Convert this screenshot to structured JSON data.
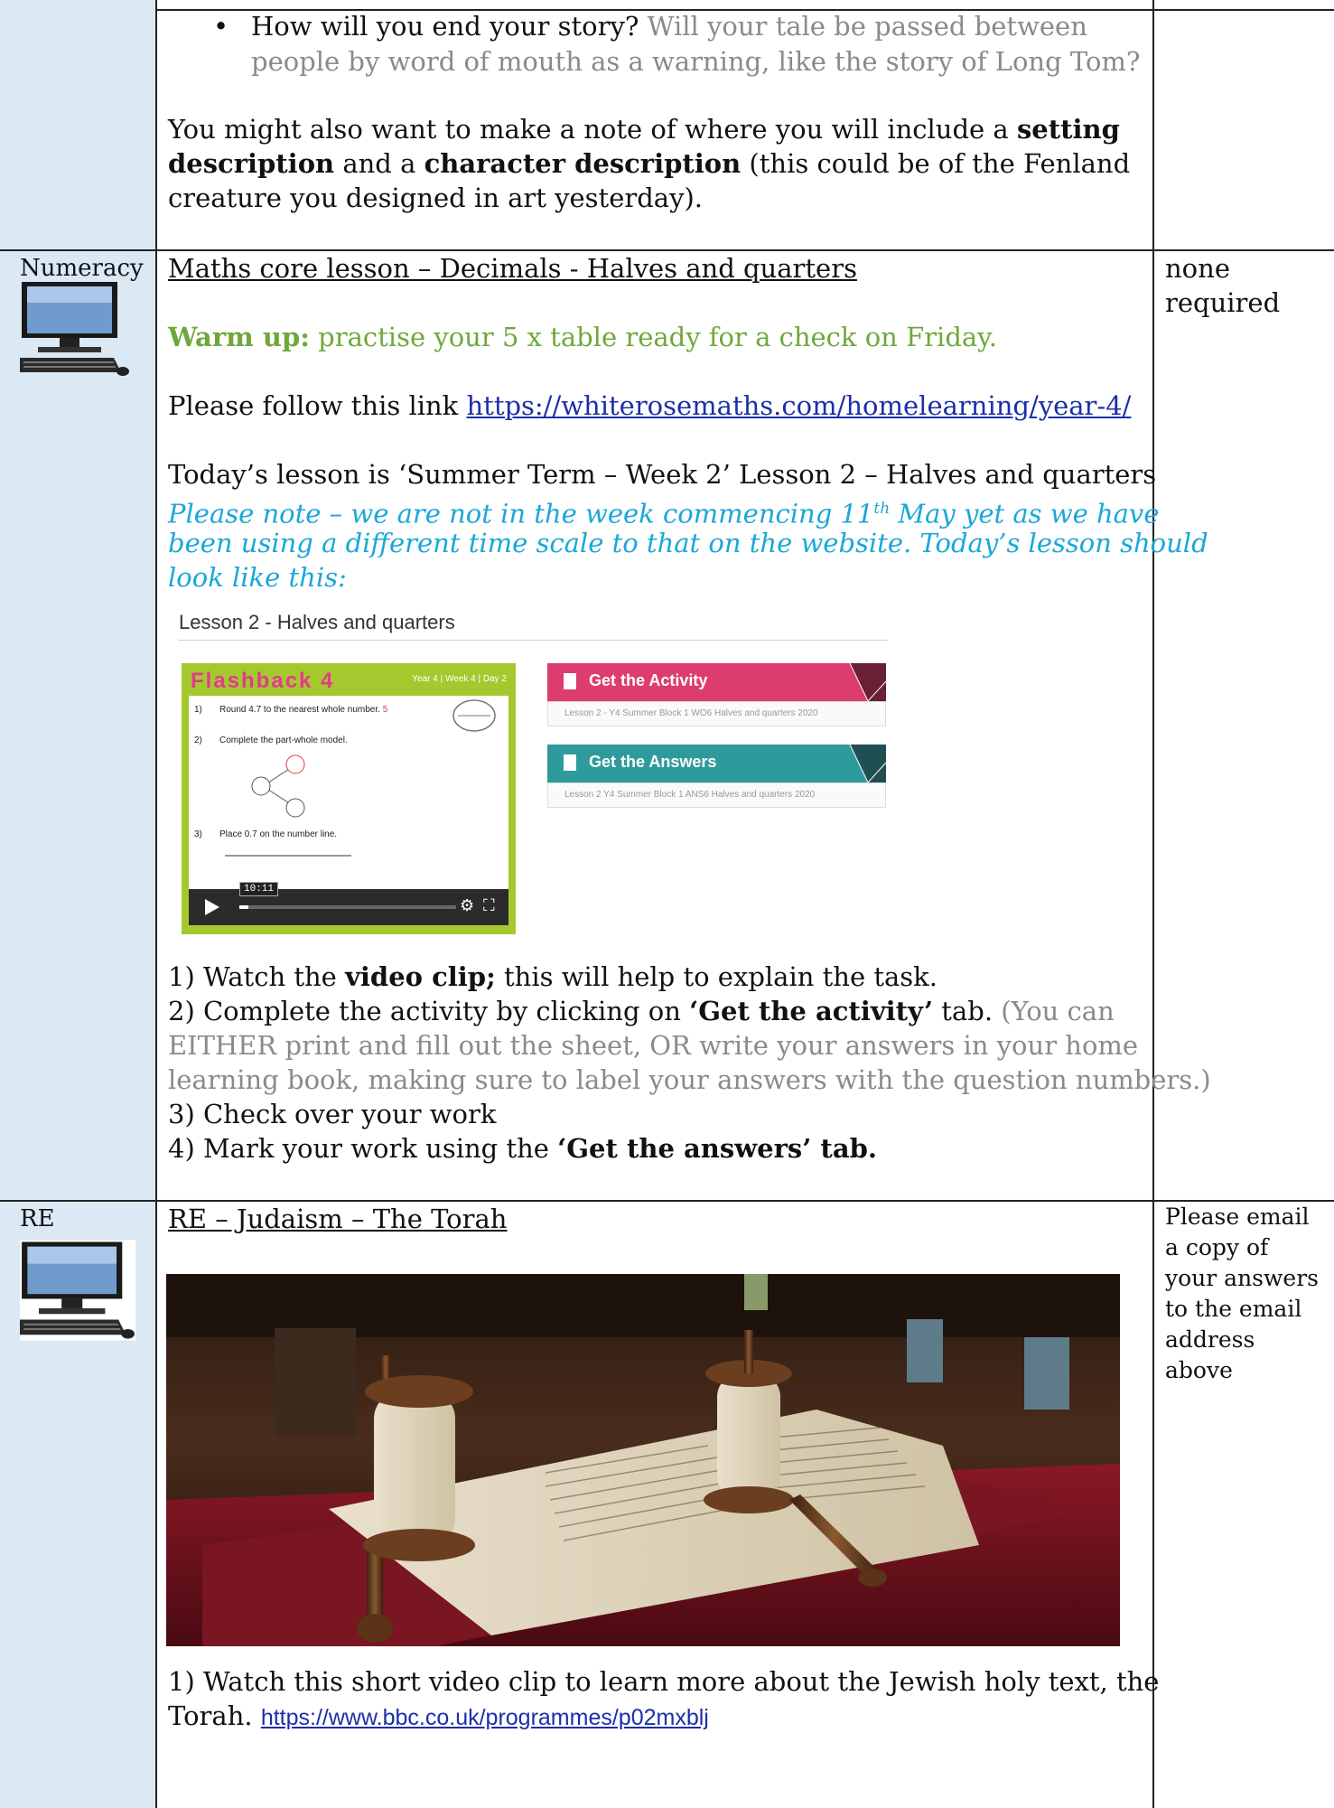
{
  "top": {
    "bullet_lead": "How will you end your story?",
    "bullet_rest_1": "Will your tale be passed between",
    "bullet_rest_2": "people by word of mouth as a warning, like the story of Long Tom?",
    "note_1a": "You might also want to make a note of where you will include a ",
    "note_1b": "setting",
    "note_2a": "description",
    "note_2b": " and a ",
    "note_2c": "character description",
    "note_2d": " (this could be of the Fenland",
    "note_3": "creature you designed in art yesterday)."
  },
  "numeracy": {
    "subject": "Numeracy",
    "heading": "Maths core lesson – Decimals  - Halves and quarters",
    "warm_bold": "Warm up:",
    "warm_rest": " practise your 5 x table ready for a check on Friday.",
    "follow": "Please follow this link ",
    "link": "https://whiterosemaths.com/homelearning/year-4/",
    "today": "Today’s lesson is ‘Summer Term – Week 2’ Lesson 2 – Halves and quarters",
    "note_1": "Please note – we are not in the week commencing 11",
    "note_1_sup": "th",
    "note_1_end": " May yet as we have",
    "note_2": "been using a different time scale to that on the website. Today’s lesson should",
    "note_3": "look like this:",
    "lesson_panel": {
      "title": "Lesson 2 - Halves and quarters",
      "flashback": "Flashback 4",
      "meta": "Year 4 | Week 4 | Day 2",
      "q1": "Round 4.7 to the nearest whole number.",
      "q1_answer": "5",
      "q2": "Complete the part-whole model.",
      "q3": "Place 0.7 on the number line.",
      "video_time": "10:11",
      "activity_label": "Get the Activity",
      "activity_sub": "Lesson 2 - Y4 Summer Block 1 WO6 Halves and quarters 2020",
      "answers_label": "Get the Answers",
      "answers_sub": "Lesson 2 Y4 Summer Block 1 ANS6 Halves and quarters 2020"
    },
    "step_1a": "1) Watch the ",
    "step_1b": "video clip;",
    "step_1c": " this will help to explain the task.",
    "step_2a": "2) Complete the activity by clicking on ",
    "step_2b": "‘Get the activity’",
    "step_2c": " tab.",
    "step_2d": " (You can",
    "step_2e": "EITHER print and fill out the sheet, OR write your answers in your home",
    "step_2f": "learning book, making sure to label your answers with the question numbers.)",
    "step_3": "3) Check over your work",
    "step_4a": "4) Mark your work using the ",
    "step_4b": "‘Get the answers’ tab.",
    "evidence_1": "none",
    "evidence_2": "required"
  },
  "re": {
    "subject": "RE",
    "heading": "RE – Judaism – The Torah",
    "step_1a": "1) Watch this short video clip to learn more about the Jewish holy text, the",
    "step_1b": "Torah. ",
    "link": "https://www.bbc.co.uk/programmes/p02mxblj",
    "evidence": [
      "Please email",
      "a copy of",
      "your answers",
      "to the email",
      "address",
      "above"
    ]
  },
  "colors": {
    "subject_column": "#dbe9f5",
    "warm_up_green": "#6fa83a",
    "note_blue": "#1aa7d8",
    "grey_text": "#8a8a8a",
    "activity_pink": "#dd3d6e",
    "answers_teal": "#2f9a9c",
    "flashback_green": "#a5c82e"
  },
  "icons": [
    "computer-icon"
  ]
}
